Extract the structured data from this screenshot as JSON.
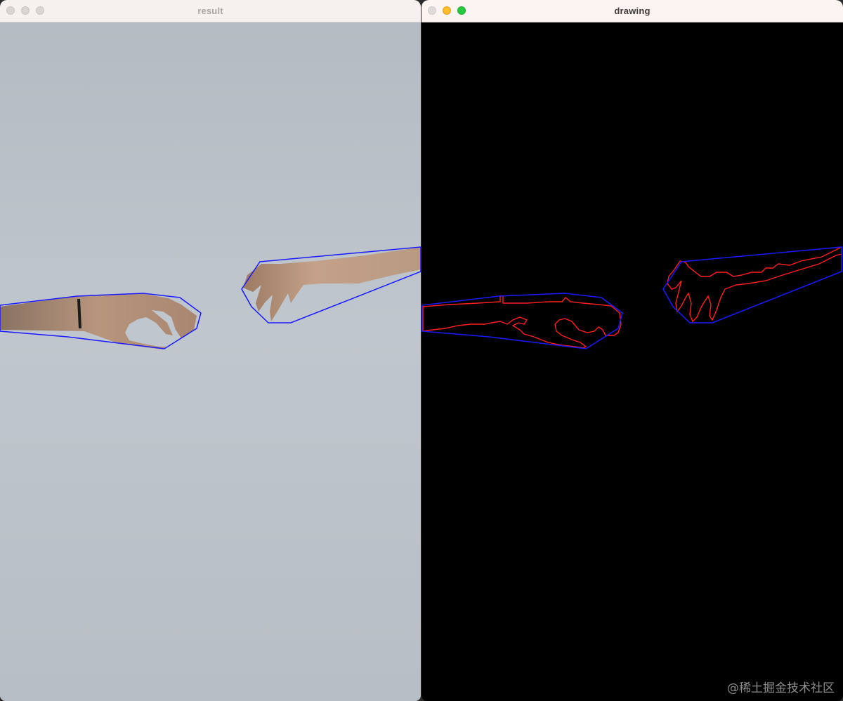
{
  "windows": {
    "result": {
      "title": "result"
    },
    "drawing": {
      "title": "drawing"
    }
  },
  "watermark": "@稀土掘金技术社区",
  "colors": {
    "hull_line": "#1a1aff",
    "contour_line": "#ff2020",
    "result_background": "#bfc5cc",
    "drawing_background": "#000000"
  }
}
